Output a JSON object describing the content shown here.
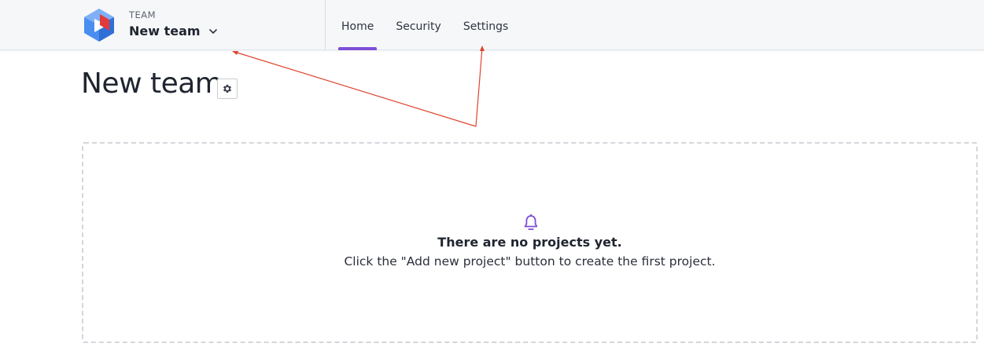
{
  "header": {
    "team_kicker": "TEAM",
    "team_name": "New team",
    "tabs": [
      {
        "label": "Home",
        "active": true
      },
      {
        "label": "Security",
        "active": false
      },
      {
        "label": "Settings",
        "active": false
      }
    ]
  },
  "page": {
    "title": "New team"
  },
  "empty_state": {
    "title": "There are no projects yet.",
    "description": "Click the \"Add new project\" button to create the first project."
  },
  "colors": {
    "accent": "#7b4fd6",
    "annotation": "#e0442e",
    "logo_blue": "#4a8ef0",
    "logo_red": "#e23a3a"
  },
  "icons": [
    "logo-icon",
    "chevron-down-icon",
    "gear-icon",
    "bell-icon"
  ]
}
